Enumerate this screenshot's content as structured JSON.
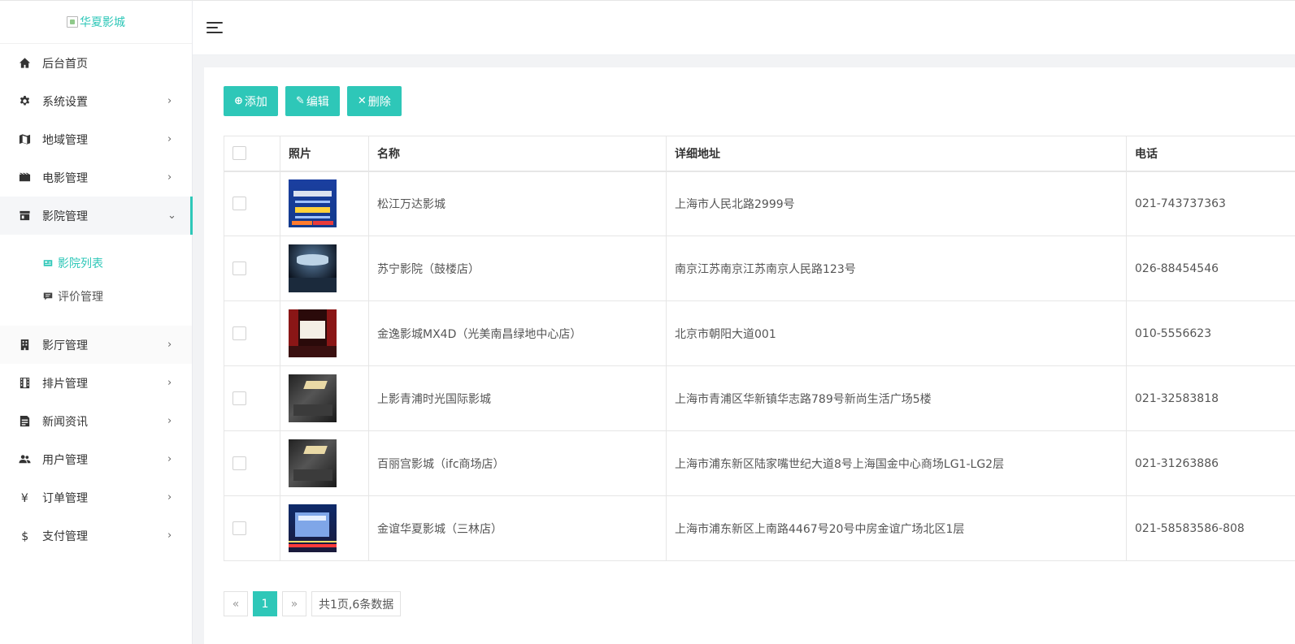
{
  "logo": {
    "alt_text": "华夏影城"
  },
  "sidebar": {
    "items": [
      {
        "label": "后台首页",
        "icon": "home-icon",
        "has_children": false
      },
      {
        "label": "系统设置",
        "icon": "gear-icon",
        "has_children": true
      },
      {
        "label": "地域管理",
        "icon": "map-icon",
        "has_children": true
      },
      {
        "label": "电影管理",
        "icon": "film-icon",
        "has_children": true
      },
      {
        "label": "影院管理",
        "icon": "store-icon",
        "has_children": true,
        "expanded": true,
        "children": [
          {
            "label": "影院列表",
            "icon": "card-icon",
            "current": true
          },
          {
            "label": "评价管理",
            "icon": "comment-icon",
            "current": false
          }
        ]
      },
      {
        "label": "影厅管理",
        "icon": "building-icon",
        "has_children": true
      },
      {
        "label": "排片管理",
        "icon": "filmstrip-icon",
        "has_children": true
      },
      {
        "label": "新闻资讯",
        "icon": "news-icon",
        "has_children": true
      },
      {
        "label": "用户管理",
        "icon": "users-icon",
        "has_children": true
      },
      {
        "label": "订单管理",
        "icon": "yen-icon",
        "has_children": true
      },
      {
        "label": "支付管理",
        "icon": "dollar-icon",
        "has_children": true
      }
    ]
  },
  "toolbar": {
    "add_label": "添加",
    "edit_label": "编辑",
    "delete_label": "删除"
  },
  "table": {
    "columns": [
      "照片",
      "名称",
      "详细地址",
      "电话"
    ],
    "rows": [
      {
        "name": "松江万达影城",
        "address": "上海市人民北路2999号",
        "phone": "021-743737363",
        "thumb": "poster"
      },
      {
        "name": "苏宁影院（鼓楼店）",
        "address": "南京江苏南京江苏南京人民路123号",
        "phone": "026-88454546",
        "thumb": "hall-blue"
      },
      {
        "name": "金逸影城MX4D（光美南昌绿地中心店）",
        "address": "北京市朝阳大道001",
        "phone": "010-5556623",
        "thumb": "screen-red"
      },
      {
        "name": "上影青浦时光国际影城",
        "address": "上海市青浦区华新镇华志路789号新尚生活广场5楼",
        "phone": "021-32583818",
        "thumb": "lobby"
      },
      {
        "name": "百丽宫影城（ifc商场店）",
        "address": "上海市浦东新区陆家嘴世纪大道8号上海国金中心商场LG1-LG2层",
        "phone": "021-31263886",
        "thumb": "lobby"
      },
      {
        "name": "金谊华夏影城（三林店）",
        "address": "上海市浦东新区上南路4467号20号中房金谊广场北区1层",
        "phone": "021-58583586-808",
        "thumb": "building-night"
      }
    ]
  },
  "pager": {
    "prev": "«",
    "current": "1",
    "next": "»",
    "info": "共1页,6条数据"
  },
  "colors": {
    "accent": "#2ec7b8"
  }
}
